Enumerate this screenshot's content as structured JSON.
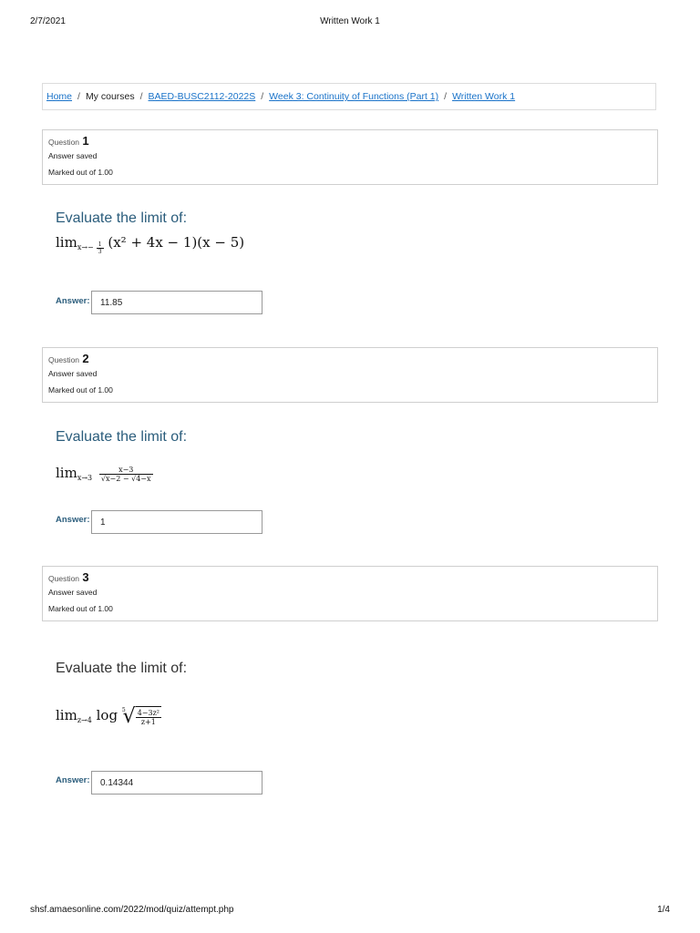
{
  "print_header": {
    "date": "2/7/2021",
    "title": "Written Work 1"
  },
  "breadcrumb": {
    "home": "Home",
    "my_courses": "My courses",
    "course": "BAED-BUSC2112-2022S",
    "week": "Week 3: Continuity of Functions (Part 1)",
    "quiz": "Written Work 1",
    "separator": "/"
  },
  "questions": [
    {
      "label": "Question",
      "number": "1",
      "state": "Answer saved",
      "grade": "Marked out of 1.00",
      "prompt": "Evaluate the limit of:",
      "math": {
        "lim": "lim",
        "sub_var": "x",
        "sub_arrow": "→",
        "sub_target_sign": "−",
        "sub_frac_num": "1",
        "sub_frac_den": "3",
        "expr": "(x² + 4x − 1)(x − 5)"
      },
      "answer_label": "Answer:",
      "answer_value": "11.85"
    },
    {
      "label": "Question",
      "number": "2",
      "state": "Answer saved",
      "grade": "Marked out of 1.00",
      "prompt": "Evaluate the limit of:",
      "math": {
        "lim": "lim",
        "sub": "x→3",
        "frac_num": "x−3",
        "frac_den": "√x−2 − √4−x"
      },
      "answer_label": "Answer:",
      "answer_value": "1"
    },
    {
      "label": "Question",
      "number": "3",
      "state": "Answer saved",
      "grade": "Marked out of 1.00",
      "prompt": "Evaluate the limit of:",
      "math": {
        "lim": "lim",
        "sub": "z→4",
        "log": "log",
        "root_index": "5",
        "root_num": "4−3z²",
        "root_den": "z+1"
      },
      "answer_label": "Answer:",
      "answer_value": "0.14344"
    }
  ],
  "print_footer": {
    "url": "shsf.amaesonline.com/2022/mod/quiz/attempt.php",
    "page": "1/4"
  },
  "colors": {
    "link": "#1a73c9",
    "prompt": "#2b5d7c",
    "border": "#cfcfcf"
  }
}
